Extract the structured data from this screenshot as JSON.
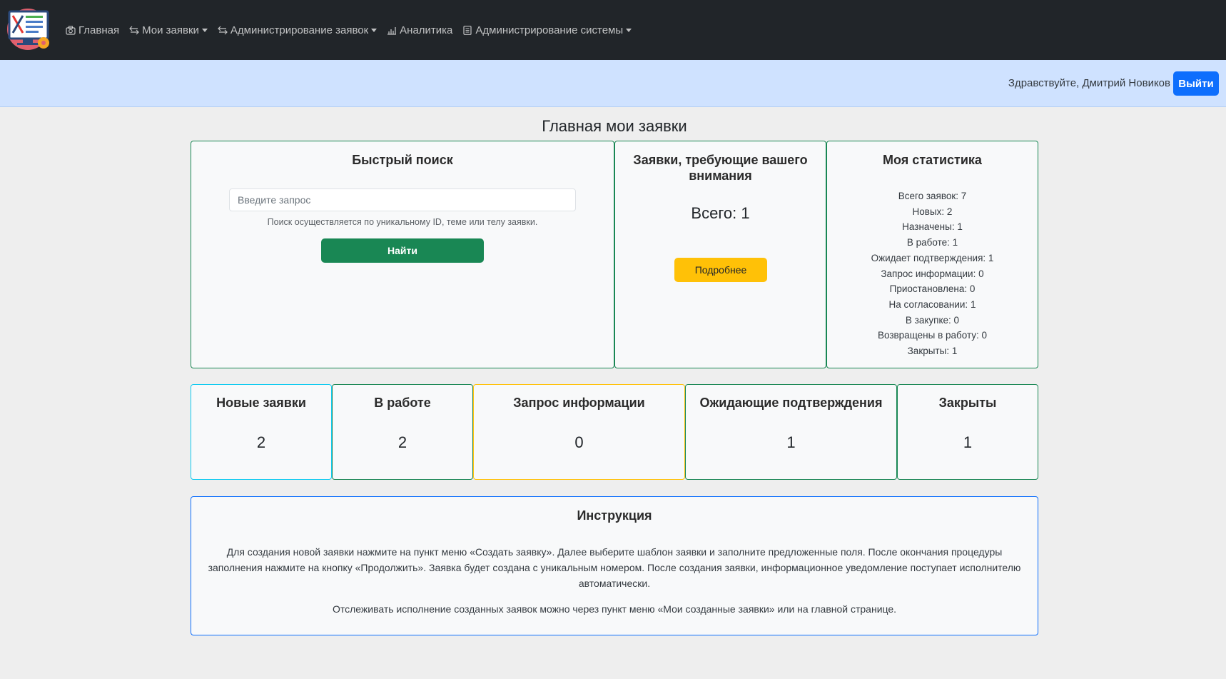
{
  "nav": {
    "items": [
      {
        "label": "Главная",
        "icon": "camera-icon",
        "dropdown": false
      },
      {
        "label": "Мои заявки",
        "icon": "arrows-exchange-icon",
        "dropdown": true
      },
      {
        "label": "Администрирование заявок",
        "icon": "arrows-exchange-icon",
        "dropdown": true
      },
      {
        "label": "Аналитика",
        "icon": "bar-chart-icon",
        "dropdown": false
      },
      {
        "label": "Администрирование системы",
        "icon": "document-icon",
        "dropdown": true
      }
    ]
  },
  "user": {
    "greeting": "Здравствуйте, Дмитрий Новиков",
    "logout_label": "Выйти"
  },
  "page": {
    "title": "Главная мои заявки"
  },
  "search": {
    "title": "Быстрый поиск",
    "placeholder": "Введите запрос",
    "hint": "Поиск осуществляется по уникальному ID, теме или телу заявки.",
    "button_label": "Найти"
  },
  "attention": {
    "title": "Заявки, требующие вашего внимания",
    "total": "Всего: 1",
    "button_label": "Подробнее"
  },
  "stats": {
    "title": "Моя статистика",
    "lines": [
      "Всего заявок: 7",
      "Новых: 2",
      "Назначены: 1",
      "В работе: 1",
      "Ожидает подтверждения: 1",
      "Запрос информации: 0",
      "Приостановлена: 0",
      "На согласовании: 1",
      "В закупке: 0",
      "Возвращены в работу: 0",
      "Закрыты: 1"
    ]
  },
  "status_cards": [
    {
      "title": "Новые заявки",
      "count": "2",
      "color": "#0dcaf0"
    },
    {
      "title": "В работе",
      "count": "2",
      "color": "#198754"
    },
    {
      "title": "Запрос информации",
      "count": "0",
      "color": "#ffc107"
    },
    {
      "title": "Ожидающие подтверждения",
      "count": "1",
      "color": "#198754"
    },
    {
      "title": "Закрыты",
      "count": "1",
      "color": "#198754"
    }
  ],
  "instructions": {
    "title": "Инструкция",
    "paragraph1": "Для создания новой заявки нажмите на пункт меню «Создать заявку». Далее выберите шаблон заявки и заполните предложенные поля. После окончания процедуры заполнения нажмите на кнопку «Продолжить». Заявка будет создана с уникальным номером. После создания заявки, информационное уведомление поступает исполнителю автоматически.",
    "paragraph2": "Отслеживать исполнение созданных заявок можно через пункт меню «Мои созданные заявки» или на главной странице."
  },
  "colors": {
    "navbar": "#212529",
    "userbar": "#cfe2ff",
    "primary": "#0d6efd",
    "success": "#198754",
    "warning": "#ffc107",
    "info": "#0dcaf0"
  }
}
